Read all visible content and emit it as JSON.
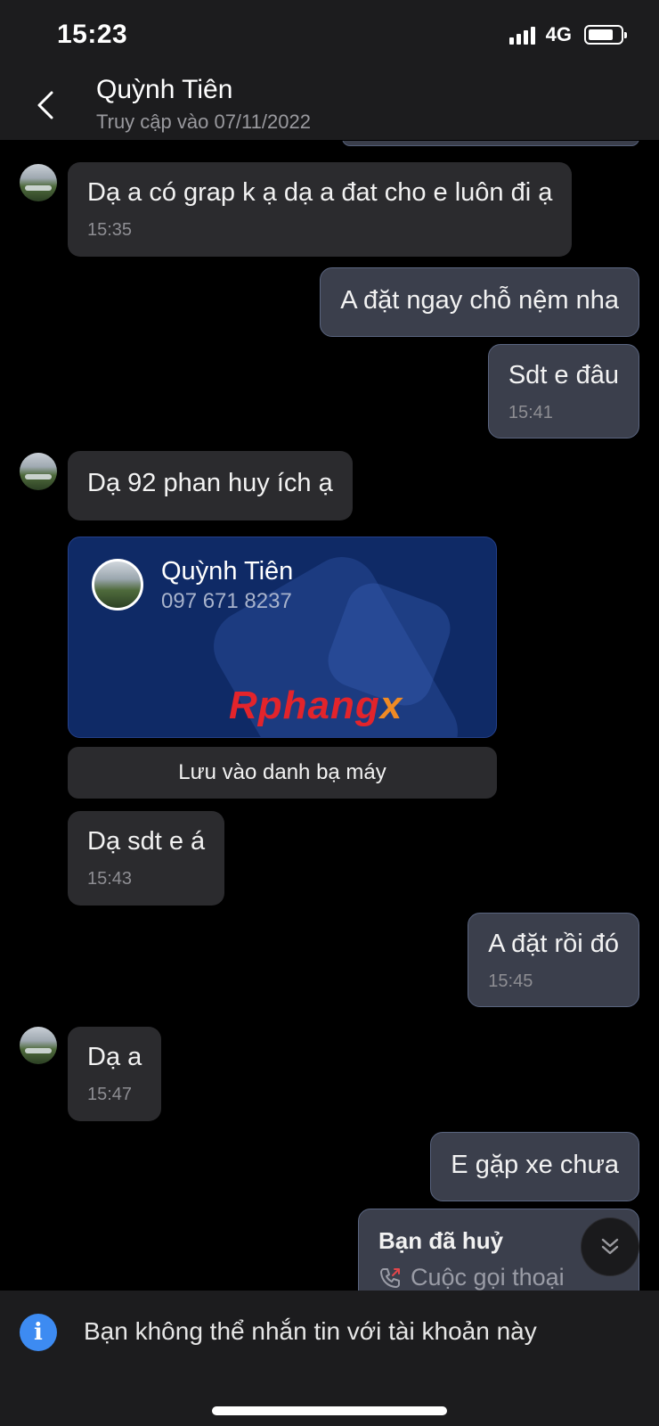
{
  "status_bar": {
    "time": "15:23",
    "network": "4G"
  },
  "header": {
    "name": "Quỳnh Tiên",
    "status": "Truy cập vào 07/11/2022"
  },
  "messages": [
    {
      "text": "Dạ a có grap k ạ dạ a đat cho e luôn đi ạ",
      "time": "15:35"
    },
    {
      "text": "A đặt ngay chỗ nệm nha"
    },
    {
      "text": "Sdt e đâu",
      "time": "15:41"
    },
    {
      "text": "Dạ 92 phan huy ích ạ"
    },
    {
      "text": "Dạ sdt e á",
      "time": "15:43"
    },
    {
      "text": "A đặt rồi đó",
      "time": "15:45"
    },
    {
      "text": "Dạ a",
      "time": "15:47"
    },
    {
      "text": "E gặp xe chưa"
    }
  ],
  "contact_card": {
    "name": "Quỳnh Tiên",
    "phone": "097 671 8237",
    "watermark_main": "Rphang",
    "watermark_end": "x",
    "save_label": "Lưu vào danh bạ máy"
  },
  "call": {
    "title": "Bạn đã huỷ",
    "subtitle": "Cuộc gọi thoại"
  },
  "footer": {
    "notice": "Bạn không thể nhắn tin với tài khoản này"
  },
  "colors": {
    "incoming_bubble": "#2b2b2e",
    "outgoing_bubble": "#3b3f4c",
    "card_bg": "#0f2a66",
    "info_accent": "#3d8bf2",
    "logo_red": "#e3242b",
    "logo_orange": "#f08a24"
  },
  "icons": [
    "back-chevron-icon",
    "signal-icon",
    "battery-icon",
    "info-icon",
    "outgoing-call-icon",
    "double-chevron-down-icon"
  ]
}
